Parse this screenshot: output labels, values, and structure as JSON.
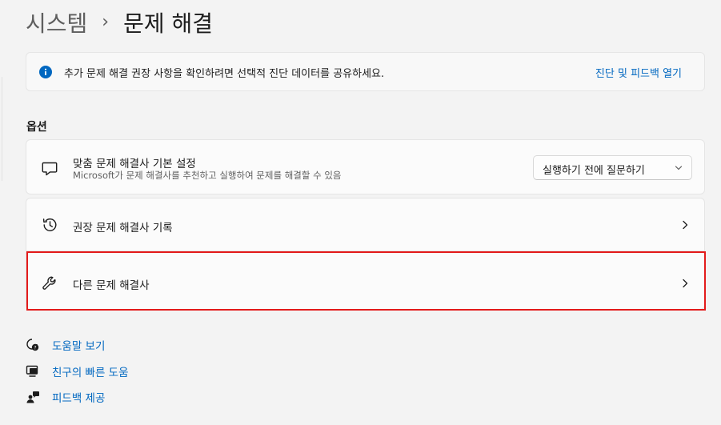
{
  "breadcrumb": {
    "parent": "시스템",
    "separator": "›",
    "current": "문제 해결"
  },
  "info_bar": {
    "icon": "info-icon",
    "message": "추가 문제 해결 권장 사항을 확인하려면 선택적 진단 데이터를 공유하세요.",
    "link": "진단 및 피드백 열기"
  },
  "options": {
    "title": "옵션",
    "preferences": {
      "icon": "chat-bubble-icon",
      "title": "맞춤 문제 해결사 기본 설정",
      "subtitle": "Microsoft가 문제 해결사를 추천하고 실행하여 문제를 해결할 수 있음",
      "dropdown_value": "실행하기 전에 질문하기"
    },
    "history": {
      "icon": "history-icon",
      "title": "권장 문제 해결사 기록"
    },
    "other": {
      "icon": "wrench-icon",
      "title": "다른 문제 해결사"
    }
  },
  "help_links": [
    {
      "icon": "help-chat-icon",
      "label": "도움말 보기"
    },
    {
      "icon": "remote-assist-icon",
      "label": "친구의 빠른 도움"
    },
    {
      "icon": "feedback-icon",
      "label": "피드백 제공"
    }
  ],
  "colors": {
    "background": "#f3f3f3",
    "card": "#fbfbfb",
    "accent": "#0067c0",
    "highlight": "#e31b1b"
  }
}
